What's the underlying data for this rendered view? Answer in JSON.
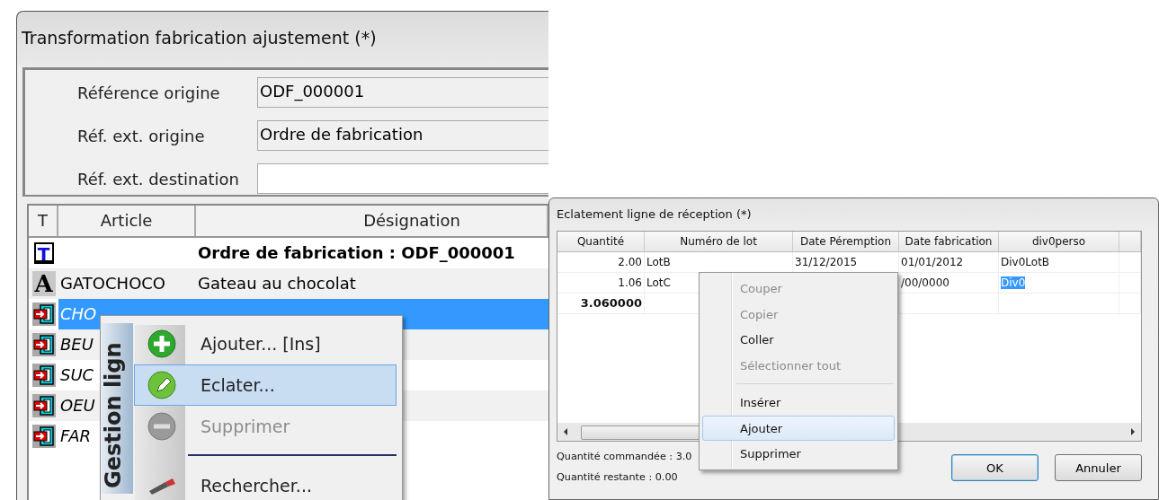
{
  "left_window": {
    "title": "Transformation fabrication ajustement (*)",
    "fields": [
      {
        "label": "Référence origine",
        "value": "ODF_000001",
        "readonly": true
      },
      {
        "label": "Réf. ext. origine",
        "value": "Ordre de fabrication",
        "readonly": true
      },
      {
        "label": "Réf. ext. destination",
        "readonly": false
      }
    ],
    "grid": {
      "columns": [
        "T",
        "Article",
        "Désignation"
      ],
      "rows": [
        {
          "kind": "title",
          "type_mark": "T",
          "designation": "Ordre de fabrication : ODF_000001",
          "selected": false
        },
        {
          "kind": "article",
          "type_mark": "A",
          "article": "GATOCHOCO",
          "designation": "Gateau au chocolat",
          "selected": false
        },
        {
          "kind": "component",
          "article": "CHO",
          "selected": true
        },
        {
          "kind": "component",
          "article": "BEU",
          "selected": false
        },
        {
          "kind": "component",
          "article": "SUC",
          "selected": false
        },
        {
          "kind": "component",
          "article": "OEU",
          "selected": false
        },
        {
          "kind": "component",
          "article": "FAR",
          "selected": false
        }
      ]
    },
    "context_menu": {
      "side_label": "Gestion lign",
      "items": [
        {
          "kind": "item",
          "label": "Ajouter... [Ins]",
          "disabled": false,
          "selected": false
        },
        {
          "kind": "item",
          "label": "Eclater...",
          "disabled": false,
          "selected": true
        },
        {
          "kind": "item",
          "label": "Supprimer",
          "disabled": true,
          "selected": false
        },
        {
          "kind": "separator"
        },
        {
          "kind": "item",
          "label": "Rechercher...",
          "disabled": false,
          "selected": false
        }
      ]
    }
  },
  "right_window": {
    "title": "Eclatement ligne de réception (*)",
    "grid": {
      "columns": [
        "Quantité",
        "Numéro de lot",
        "Date Péremption",
        "Date fabrication",
        "div0perso"
      ],
      "rows": [
        {
          "kind": "line",
          "quantity": "2.00",
          "lot": "LotB",
          "expiry": "31/12/2015",
          "made": "01/01/2012",
          "div0": "Div0LotB",
          "div0_selected": false
        },
        {
          "kind": "line",
          "quantity": "1.06",
          "lot": "LotC",
          "made": "/00/0000",
          "div0": "Div0",
          "div0_selected": true
        },
        {
          "kind": "total",
          "quantity": "3.060000"
        }
      ]
    },
    "ordered": "Quantité commandée : 3.0",
    "remaining": "Quantité restante  : 0.00",
    "buttons": [
      {
        "label": "OK",
        "default": true
      },
      {
        "label": "Annuler",
        "default": false
      }
    ],
    "context_menu": {
      "items": [
        {
          "kind": "item",
          "label": "Couper",
          "disabled": true,
          "selected": false
        },
        {
          "kind": "item",
          "label": "Copier",
          "disabled": true,
          "selected": false
        },
        {
          "kind": "item",
          "label": "Coller",
          "disabled": false,
          "selected": false
        },
        {
          "kind": "item",
          "label": "Sélectionner tout",
          "disabled": true,
          "selected": false
        },
        {
          "kind": "separator"
        },
        {
          "kind": "item",
          "label": "Insérer",
          "disabled": false,
          "selected": false
        },
        {
          "kind": "item",
          "label": "Ajouter",
          "disabled": false,
          "selected": true
        },
        {
          "kind": "item",
          "label": "Supprimer",
          "disabled": false,
          "selected": false
        }
      ]
    }
  }
}
